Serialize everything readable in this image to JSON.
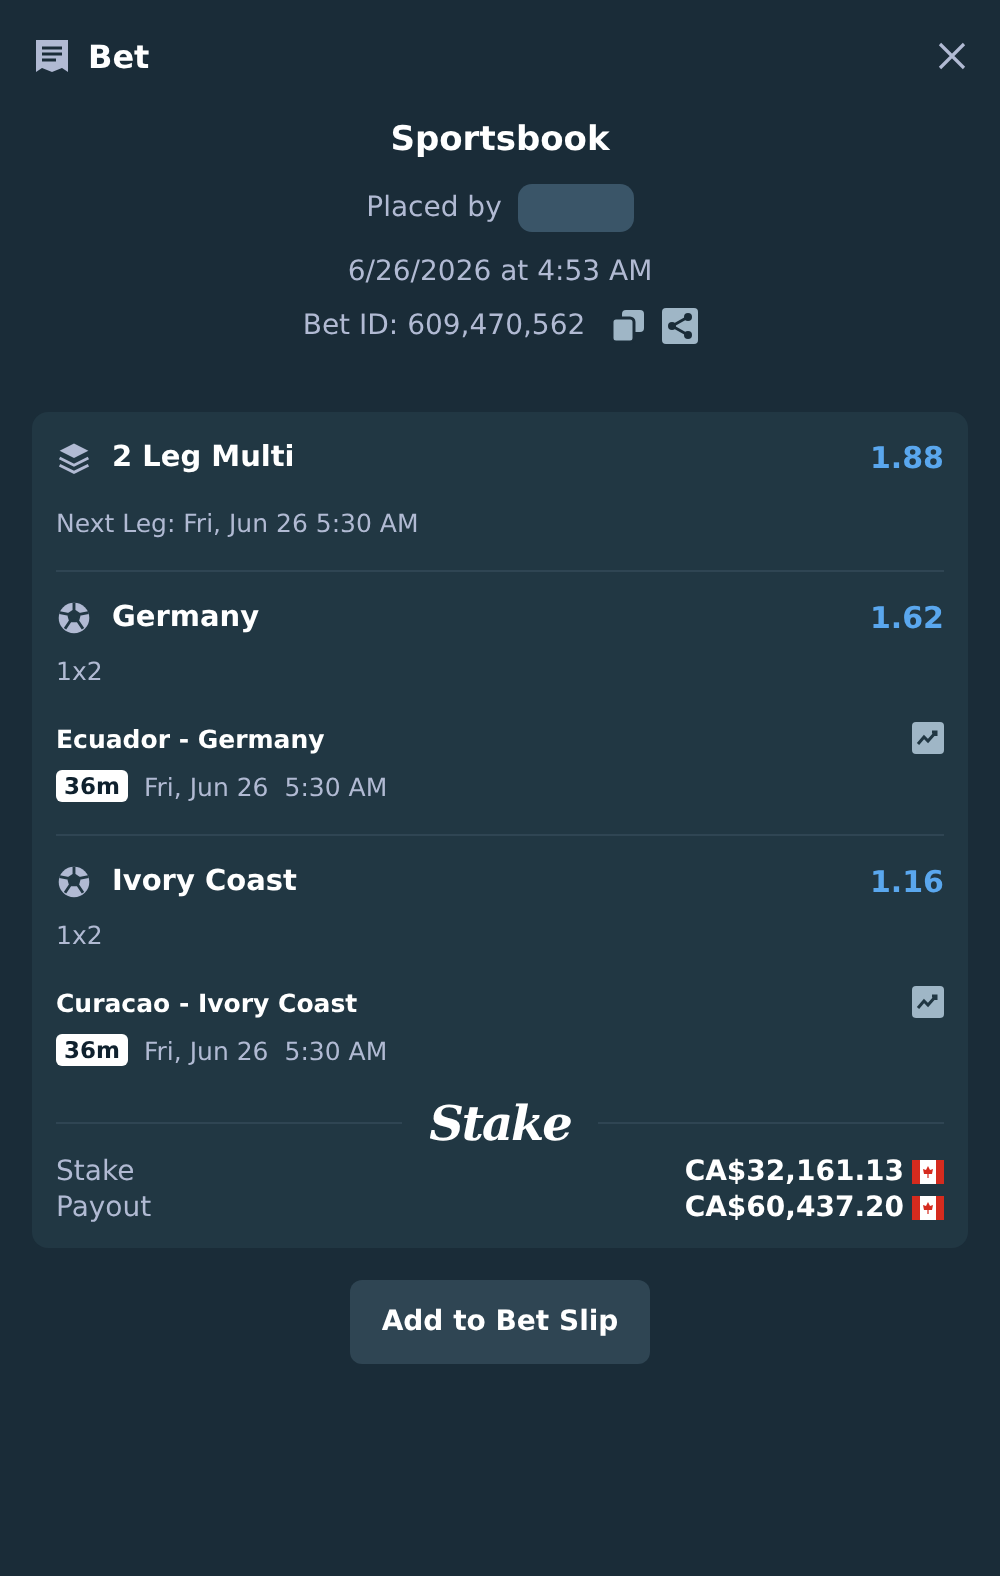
{
  "header": {
    "title": "Bet"
  },
  "summary": {
    "title": "Sportsbook",
    "placed_by": "Placed by",
    "date": "6/26/2026 at 4:53 AM",
    "bet_id": "Bet ID: 609,470,562"
  },
  "multi": {
    "title": "2 Leg Multi",
    "odds": "1.88",
    "next_leg": "Next Leg: Fri, Jun 26 5:30 AM"
  },
  "legs": [
    {
      "selection": "Germany",
      "odds": "1.62",
      "market": "1x2",
      "match": "Ecuador - Germany",
      "countdown": "36m",
      "date": "Fri, Jun 26",
      "time": "5:30 AM"
    },
    {
      "selection": "Ivory Coast",
      "odds": "1.16",
      "market": "1x2",
      "match": "Curacao - Ivory Coast",
      "countdown": "36m",
      "date": "Fri, Jun 26",
      "time": "5:30 AM"
    }
  ],
  "logo": "Stake",
  "totals": [
    {
      "label": "Stake",
      "amount": "CA$32,161.13"
    },
    {
      "label": "Payout",
      "amount": "CA$60,437.20"
    }
  ],
  "button": "Add to Bet Slip"
}
